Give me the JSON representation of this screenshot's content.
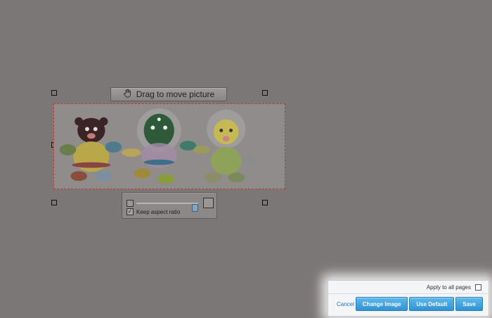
{
  "editor": {
    "drag_label": "Drag to move picture",
    "keep_aspect_label": "Keep aspect ratio",
    "keep_aspect_checked": true,
    "scale_fraction": 1.0
  },
  "actions": {
    "apply_label": "Apply to all pages",
    "apply_checked": false,
    "cancel_label": "Cancel",
    "change_image_label": "Change Image",
    "use_default_label": "Use Default",
    "save_label": "Save"
  },
  "colors": {
    "accent": "#2f93d3",
    "overlay": "#7b7776",
    "selection_border": "#c0392b"
  },
  "icons": [
    "hand-icon",
    "person-small-icon",
    "person-large-icon",
    "checkbox-icon"
  ]
}
